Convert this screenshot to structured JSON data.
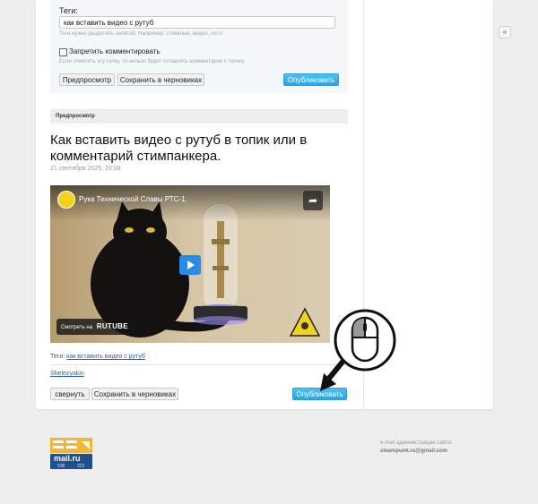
{
  "form": {
    "tags_label": "Теги:",
    "tags_value": "как вставить видео с рутуб",
    "tags_hint": "Теги нужно разделять запятой. Например: стимпанк, видео, гоггл",
    "no_comments_label": "Запретить комментировать",
    "no_comments_hint": "Если отметить эту галку, то нельзя будет оставлять комментарии к топику",
    "preview_button": "Предпросмотр",
    "save_draft_button": "Сохранить в черновиках",
    "publish_button": "Опубликовать"
  },
  "preview": {
    "header": "Предпросмотр",
    "title": "Как вставить видео с рутуб в топик или в комментарий стимпанкера.",
    "date": "21 сентября 2025, 20:08",
    "tags_prefix": "Теги:",
    "tag": "как вставить видео с рутуб",
    "author": "Shelezyakin",
    "collapse_button": "свернуть",
    "save_draft_button": "Сохранить в черновиках",
    "publish_button": "Опубликовать"
  },
  "video": {
    "title": "Рука Технической Славы РТС-1.",
    "watch_on": "Смотреть на",
    "brand": "RUTUBE"
  },
  "footer": {
    "email_label": "e-mail администрации сайта:",
    "email": "steampunk.ru@gmail.com",
    "counter_brand": "mail.ru",
    "counter_a": "538",
    "counter_b": "323"
  }
}
